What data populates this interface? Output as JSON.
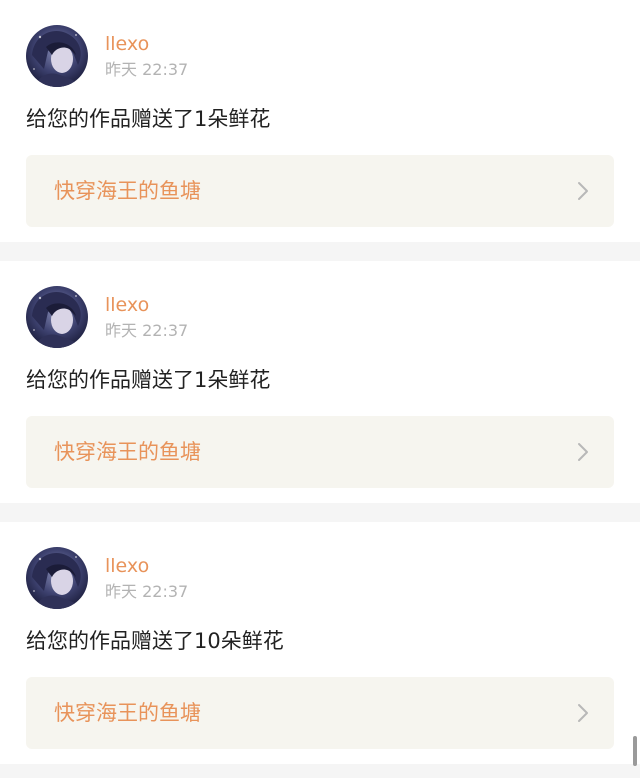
{
  "notifications": [
    {
      "user": "llexo",
      "time": "昨天 22:37",
      "message": "给您的作品赠送了1朵鲜花",
      "work_title": "快穿海王的鱼塘",
      "avatar_icon": "user-avatar"
    },
    {
      "user": "llexo",
      "time": "昨天 22:37",
      "message": "给您的作品赠送了1朵鲜花",
      "work_title": "快穿海王的鱼塘",
      "avatar_icon": "user-avatar"
    },
    {
      "user": "llexo",
      "time": "昨天 22:37",
      "message": "给您的作品赠送了10朵鲜花",
      "work_title": "快穿海王的鱼塘",
      "avatar_icon": "user-avatar"
    }
  ],
  "colors": {
    "accent": "#e8935a",
    "timestamp": "#b3b3b3",
    "text": "#222222",
    "link_bg": "#f6f5ef",
    "page_bg": "#f5f5f5"
  },
  "icons": {
    "link_chevron": "chevron-right-icon"
  }
}
